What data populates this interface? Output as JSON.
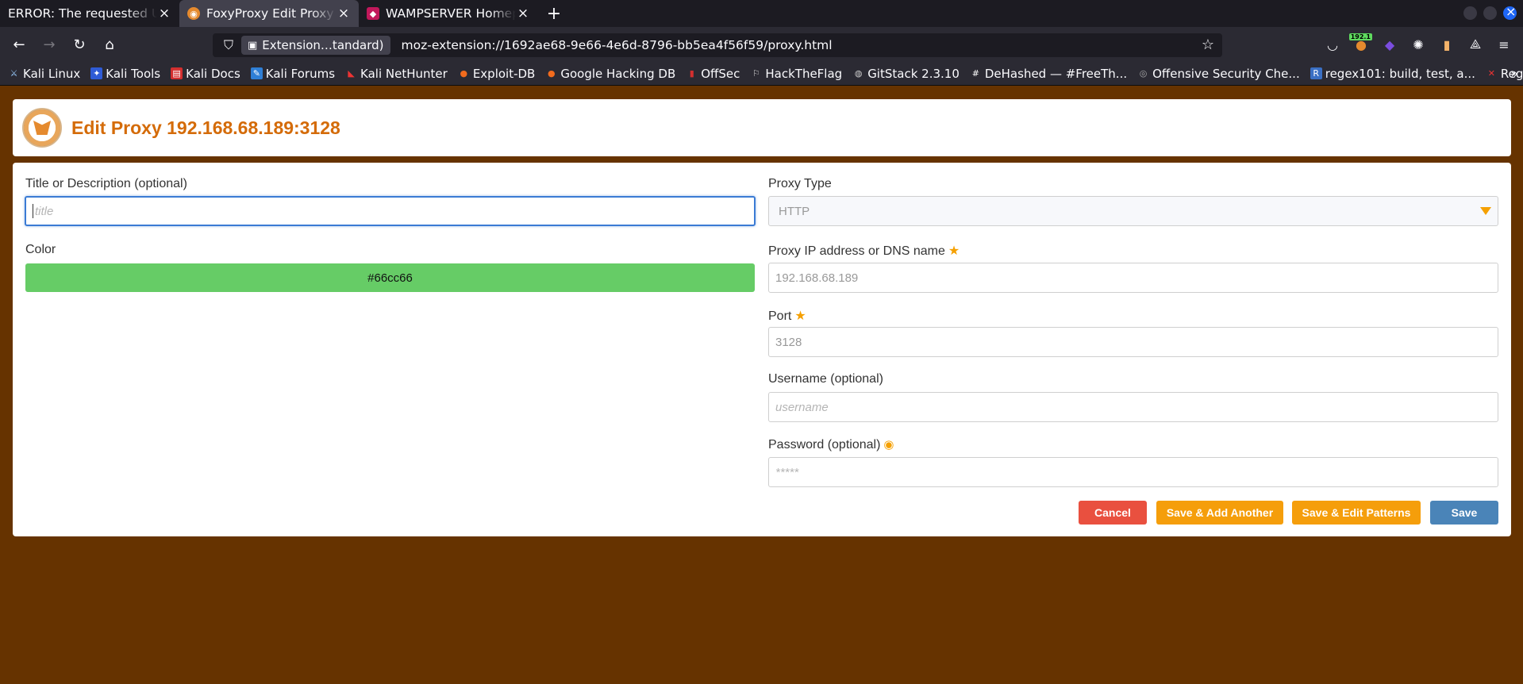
{
  "tabs": [
    {
      "title": "ERROR: The requested URL c",
      "active": false,
      "favicon": "none"
    },
    {
      "title": "FoxyProxy Edit Proxy",
      "active": true,
      "favicon": "fox-icon"
    },
    {
      "title": "WAMPSERVER Homepage",
      "active": false,
      "favicon": "wamp-icon"
    }
  ],
  "tab_close": "×",
  "new_tab": "+",
  "nav": {
    "identity_label": "Extension…tandard)",
    "url": "moz-extension://1692ae68-9e66-4e6d-8796-bb5ea4f56f59/proxy.html",
    "extension_badge": "192.1"
  },
  "bookmarks": [
    "Kali Linux",
    "Kali Tools",
    "Kali Docs",
    "Kali Forums",
    "Kali NetHunter",
    "Exploit-DB",
    "Google Hacking DB",
    "OffSec",
    "HackTheFlag",
    "GitStack 2.3.10",
    "DeHashed — #FreeTh...",
    "Offensive Security Che...",
    "regex101: build, test, a...",
    "Regulex：JavaScript R..."
  ],
  "page": {
    "title": "Edit Proxy 192.168.68.189:3128"
  },
  "form": {
    "title_label": "Title or Description (optional)",
    "title_placeholder": "title",
    "color_label": "Color",
    "color_value": "#66cc66",
    "proxy_type_label": "Proxy Type",
    "proxy_type_value": "HTTP",
    "ip_label": "Proxy IP address or DNS name",
    "ip_value": "192.168.68.189",
    "port_label": "Port",
    "port_value": "3128",
    "username_label": "Username (optional)",
    "username_placeholder": "username",
    "password_label": "Password (optional)",
    "password_placeholder": "*****"
  },
  "buttons": {
    "cancel": "Cancel",
    "save_add_another": "Save & Add Another",
    "save_edit_patterns": "Save & Edit Patterns",
    "save": "Save"
  },
  "colors": {
    "page_bg": "#663300",
    "accent_orange": "#f59e0b",
    "title_orange": "#d46b08",
    "cancel_red": "#e9503f",
    "save_blue": "#4a84b8",
    "proxy_color": "#66cc66"
  }
}
